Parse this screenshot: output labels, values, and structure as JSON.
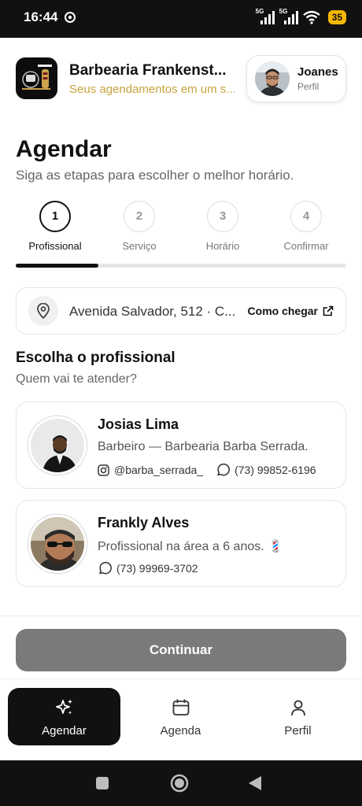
{
  "status_bar": {
    "time": "16:44",
    "network_1": "5G",
    "network_2": "5G",
    "battery": "35"
  },
  "header": {
    "business_name": "Barbearia Frankenst...",
    "tagline": "Seus agendamentos em um s...",
    "profile_name": "Joanes",
    "profile_sub": "Perfil"
  },
  "page": {
    "title": "Agendar",
    "subtitle": "Siga as etapas para escolher o melhor horário."
  },
  "steps": [
    {
      "number": "1",
      "label": "Profissional"
    },
    {
      "number": "2",
      "label": "Serviço"
    },
    {
      "number": "3",
      "label": "Horário"
    },
    {
      "number": "4",
      "label": "Confirmar"
    }
  ],
  "progress": {
    "fraction": 0.25
  },
  "address": {
    "text": "Avenida Salvador, 512 · C...",
    "link_label": "Como chegar"
  },
  "section": {
    "title": "Escolha o profissional",
    "subtitle": "Quem vai te atender?"
  },
  "professionals": [
    {
      "name": "Josias Lima",
      "description": "Barbeiro — Barbearia Barba Serrada.",
      "instagram": "@barba_serrada_",
      "phone": "(73) 99852-6196"
    },
    {
      "name": "Frankly Alves",
      "description": "Profissional na área a 6 anos. 💈",
      "phone": "(73) 99969-3702"
    }
  ],
  "continue_label": "Continuar",
  "tabs": [
    {
      "label": "Agendar",
      "icon": "sparkles-icon"
    },
    {
      "label": "Agenda",
      "icon": "calendar-icon"
    },
    {
      "label": "Perfil",
      "icon": "user-icon"
    }
  ],
  "colors": {
    "accent": "#111111",
    "tagline": "#c6a43c",
    "button_disabled": "#7a7a7a",
    "battery": "#f5b700"
  }
}
